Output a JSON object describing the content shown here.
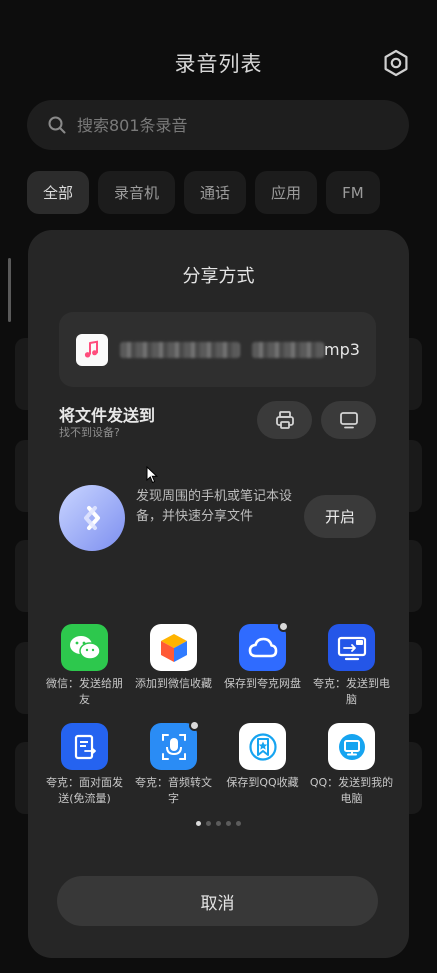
{
  "page": {
    "title": "录音列表",
    "search_placeholder": "搜索801条录音",
    "filters": [
      "全部",
      "录音机",
      "通话",
      "应用",
      "FM"
    ]
  },
  "share_sheet": {
    "title": "分享方式",
    "file": {
      "name_suffix": "mp3"
    },
    "send_to": {
      "title": "将文件发送到",
      "subtitle": "找不到设备?"
    },
    "nearby": {
      "description": "发现周围的手机或笔记本设备，并快速分享文件",
      "enable_label": "开启"
    },
    "apps": [
      {
        "label": "微信：发送给朋友",
        "icon": "wechat-icon",
        "color": "#2dc84d"
      },
      {
        "label": "添加到微信收藏",
        "icon": "wechat-favorites-icon",
        "color": "#ffffff"
      },
      {
        "label": "保存到夸克网盘",
        "icon": "quark-cloud-icon",
        "color": "#2f6bff"
      },
      {
        "label": "夸克：发送到电脑",
        "icon": "quark-pc-icon",
        "color": "#2456e8"
      },
      {
        "label": "夸克：面对面发送(免流量)",
        "icon": "quark-face-to-face-icon",
        "color": "#2563f0"
      },
      {
        "label": "夸克：音频转文字",
        "icon": "quark-audio-to-text-icon",
        "color": "#2a8cf5"
      },
      {
        "label": "保存到QQ收藏",
        "icon": "qq-favorites-icon",
        "color": "#ffffff"
      },
      {
        "label": "QQ：发送到我的电脑",
        "icon": "qq-my-computer-icon",
        "color": "#ffffff"
      }
    ],
    "pager": {
      "count": 5,
      "current": 1
    },
    "cancel_label": "取消"
  }
}
